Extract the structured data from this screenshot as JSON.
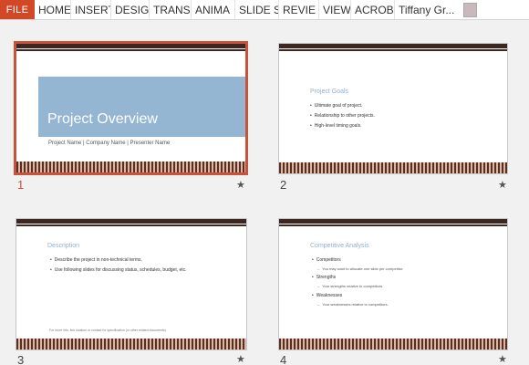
{
  "ribbon": {
    "file": "FILE",
    "tabs": [
      "HOME",
      "INSERT",
      "DESIG",
      "TRANS",
      "ANIMA",
      "SLIDE S",
      "REVIE",
      "VIEW",
      "ACROB"
    ],
    "user": "Tiffany Gr...",
    "accent_color": "#d24726"
  },
  "slides": [
    {
      "number": "1",
      "selected": true,
      "title": "Project Overview",
      "subtitle": "Project Name | Company Name | Presenter Name"
    },
    {
      "number": "2",
      "heading": "Project Goals",
      "bullets": [
        "Ultimate goal of project.",
        "Relationship to other projects.",
        "High-level timing goals."
      ]
    },
    {
      "number": "3",
      "heading": "Description",
      "bullets": [
        "Describe the project in non-technical terms.",
        "Use following slides for discussing status, schedules, budget, etc."
      ],
      "footer": "For more info, link location or contact for specification (or other related documents)."
    },
    {
      "number": "4",
      "heading": "Competitive Analysis",
      "items": [
        {
          "bullet": "Competitors",
          "sub": "You may want to allocate one slide per competitor."
        },
        {
          "bullet": "Strengths",
          "sub": "Your strengths relative to competitors."
        },
        {
          "bullet": "Weaknesses",
          "sub": "Your weaknesses relative to competitors."
        }
      ]
    }
  ],
  "star_icon": "star-icon"
}
